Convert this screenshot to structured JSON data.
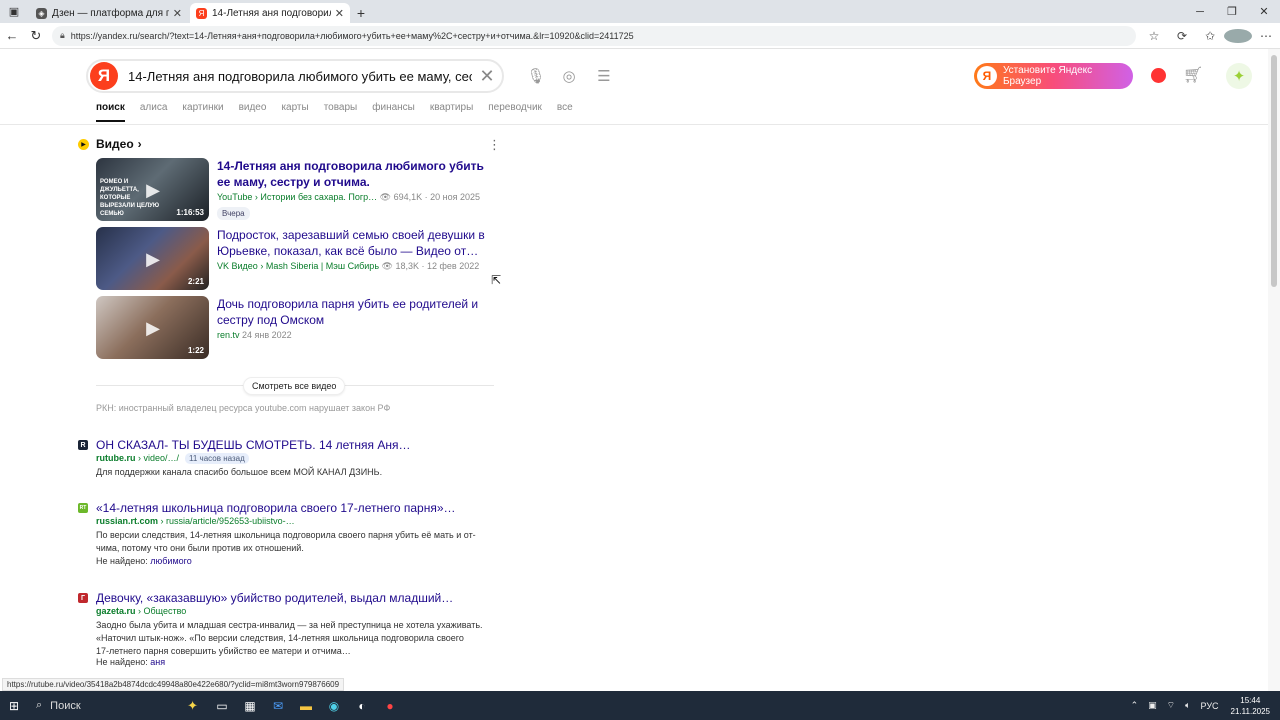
{
  "tabs": [
    {
      "title": "Дзен — платформа для просмо",
      "active": false,
      "favicon": "dzen-icon"
    },
    {
      "title": "14-Летняя аня подговорила люб",
      "active": true,
      "favicon": "yandex-icon"
    }
  ],
  "address": {
    "url": "https://yandex.ru/search/?text=14-Летняя+аня+подговорила+любимого+убить+ее+маму%2C+сестру+и+отчима.&lr=10920&clid=2411725"
  },
  "header": {
    "logo": "Я",
    "query": "14-Летняя аня подговорила любимого убить ее маму, сес...",
    "promo_logo": "Я",
    "promo_label": "Установите Яндекс Браузер"
  },
  "nav": [
    "поиск",
    "алиса",
    "картинки",
    "видео",
    "карты",
    "товары",
    "финансы",
    "квартиры",
    "переводчик",
    "все"
  ],
  "video_block": {
    "heading": "Видео",
    "items": [
      {
        "title_line1": "14-Летняя аня подговорила любимого убить",
        "title_line2": "ее маму, сестру и отчима.",
        "source": "YouTube",
        "channel": "› Истории без сахара. Погр…",
        "views": "👁 694,1K",
        "date": "· 20 ноя 2025",
        "badge": "Вчера",
        "duration": "1:16:53",
        "caption": "РОМЕО И ДЖУЛЬЕТТА, КОТОРЫЕ ВЫРЕЗАЛИ ЦЕЛУЮ СЕМЬЮ"
      },
      {
        "title_line1": "Подросток, зарезавший семью своей девушки в",
        "title_line2": "Юрьевке, показал, как всё было — Видео от…",
        "source": "VK Видео",
        "channel": "› Mash Siberia | Мэш Сибирь",
        "views": "👁 18,3K",
        "date": "· 12 фев 2022",
        "duration": "2:21"
      },
      {
        "title_line1": "Дочь подговорила парня убить ее родителей и",
        "title_line2": "сестру под Омском",
        "source": "ren.tv",
        "date": "24 янв 2022",
        "duration": "1:22"
      }
    ],
    "see_all": "Смотреть все видео",
    "rkn_note": "РКН: иностранный владелец ресурса youtube.com нарушает закон РФ"
  },
  "results": [
    {
      "favicon_letter": "R",
      "title": "ОН СКАЗАЛ- ТЫ БУДЕШЬ СМОТРЕТЬ. 14 летняя Аня…",
      "domain": "rutube.ru",
      "path": "› video/…/",
      "ago": "11 часов назад",
      "snippet": "Для поддержки канала спасибо большое всем МОЙ КАНАЛ ДЗИНЬ."
    },
    {
      "favicon_letter": "RT",
      "title": "«14-летняя школьница подговорила своего 17-летнего парня»…",
      "domain": "russian.rt.com",
      "path": "› russia/article/952653-ubiistvo-…",
      "snippet_line1": "По версии следствия, 14-летняя школьница подговорила своего парня убить её мать и от-",
      "snippet_line2": "чима, потому что они были против их отношений.",
      "not_found_label": "Не найдено:",
      "not_found_word": "любимого"
    },
    {
      "favicon_letter": "Г",
      "title": "Девочку, «заказавшую» убийство родителей, выдал младший…",
      "domain": "gazeta.ru",
      "path": "› Общество",
      "snippet_line1": "Заодно была убита и младшая сестра-инвалид — за ней преступница не хотела ухаживать.",
      "snippet_line2": "«Наточил штык-нож». «По версии следствия, 14-летняя школьница подговорила своего",
      "snippet_line3": "17-летнего парня совершить убийство ее матери и отчима…",
      "not_found_label": "Не найдено:",
      "not_found_word": "аня"
    }
  ],
  "status_url": "https://rutube.ru/video/35418a2b4874dcdc49948a80e422e680/?yclid=mi8mt3worn979876609",
  "taskbar": {
    "search_label": "Поиск",
    "lang": "РУС",
    "time": "15:44",
    "date": "21.11.2025"
  }
}
